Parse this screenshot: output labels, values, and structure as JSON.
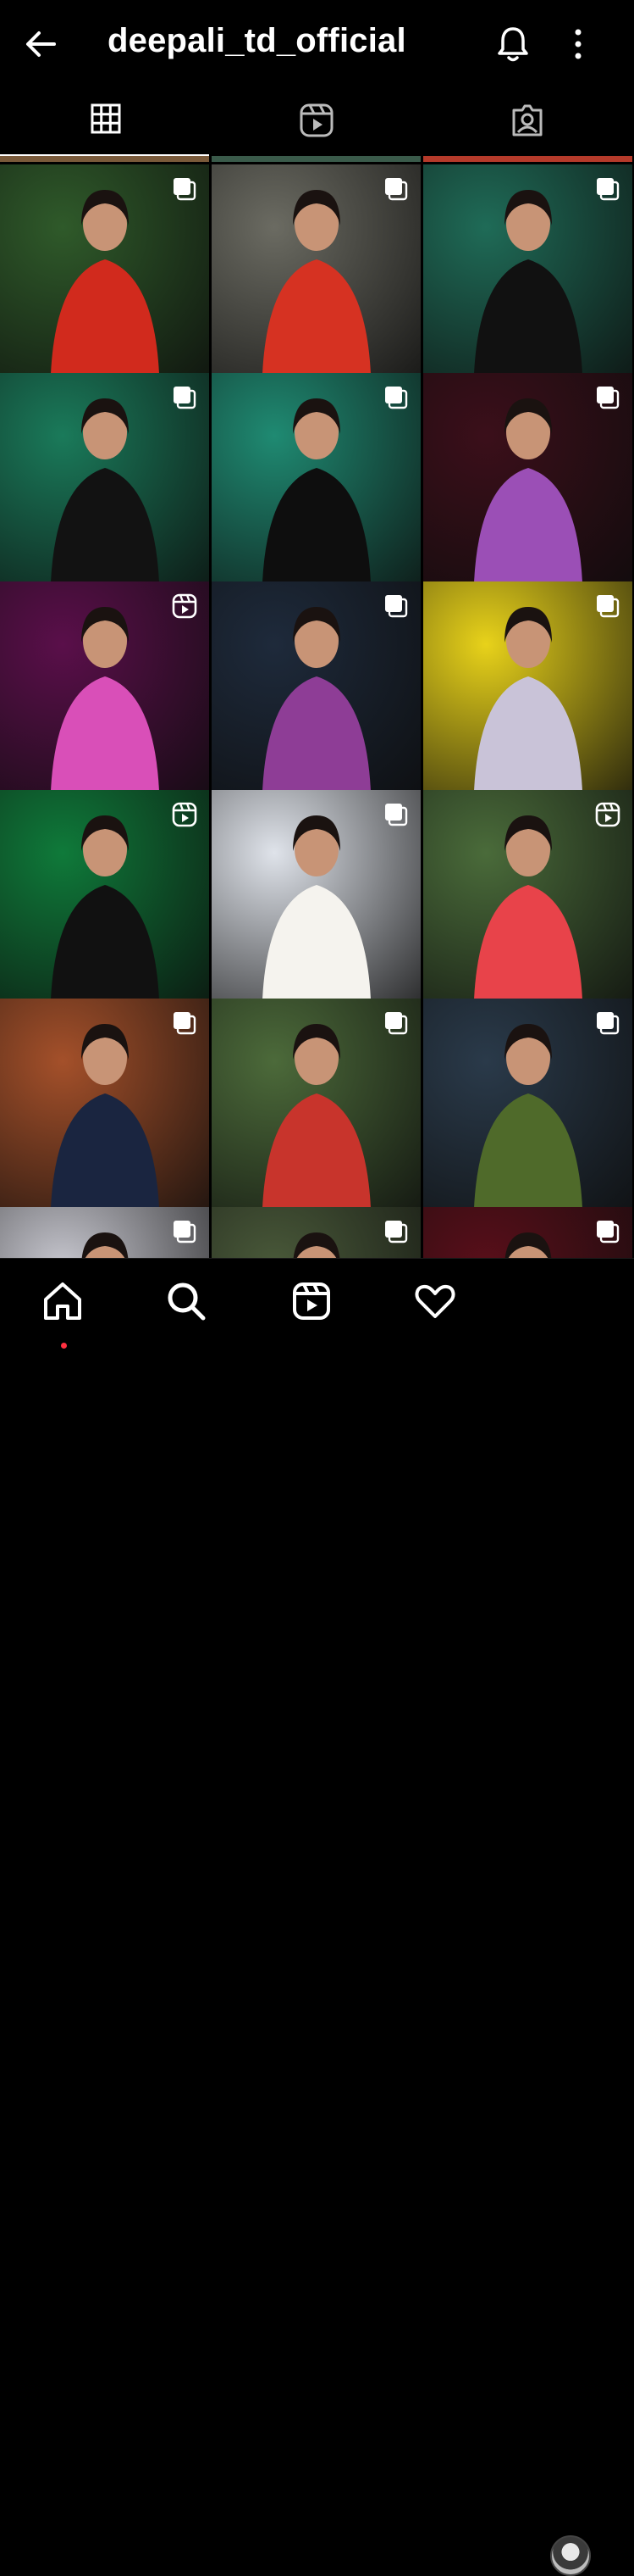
{
  "header": {
    "username": "deepali_td_official"
  },
  "tabs": [
    {
      "name": "posts",
      "icon": "grid-icon",
      "active": true
    },
    {
      "name": "reels",
      "icon": "reels-icon",
      "active": false
    },
    {
      "name": "tagged",
      "icon": "tagged-icon",
      "active": false
    }
  ],
  "grid": {
    "rows": [
      [
        {
          "badge": "multi-icon",
          "bg": "#2f5a2a",
          "accent": "#d12a1d"
        },
        {
          "badge": "multi-icon",
          "bg": "#6b6b62",
          "accent": "#d63222"
        },
        {
          "badge": "multi-icon",
          "bg": "#1f6b57",
          "accent": "#111111"
        }
      ],
      [
        {
          "badge": "multi-icon",
          "bg": "#1a7a5a",
          "accent": "#121212"
        },
        {
          "badge": "multi-icon",
          "bg": "#1f8a72",
          "accent": "#0e0e0e"
        },
        {
          "badge": "multi-icon",
          "bg": "#3b0f1a",
          "accent": "#9b4fb6"
        }
      ],
      [
        {
          "badge": "reel-icon",
          "bg": "#5a0f4a",
          "accent": "#d94fb8"
        },
        {
          "badge": "multi-icon",
          "bg": "#1e2a3b",
          "accent": "#8e3d96"
        },
        {
          "badge": "multi-icon",
          "bg": "#e8d21a",
          "accent": "#c9c3d8"
        }
      ],
      [
        {
          "badge": "reel-icon",
          "bg": "#0f7a3a",
          "accent": "#111111"
        },
        {
          "badge": "multi-icon",
          "bg": "#dfe3ea",
          "accent": "#f5f3ee"
        },
        {
          "badge": "reel-icon",
          "bg": "#4a6b3a",
          "accent": "#e8434a"
        }
      ],
      [
        {
          "badge": "multi-icon",
          "bg": "#a4502a",
          "accent": "#1a2540"
        },
        {
          "badge": "multi-icon",
          "bg": "#4c6a3a",
          "accent": "#c8342c"
        },
        {
          "badge": "multi-icon",
          "bg": "#2a3a4a",
          "accent": "#4f6a2a"
        }
      ],
      [
        {
          "badge": "multi-icon",
          "bg": "#c8c8d0",
          "accent": "#6a4a3a"
        },
        {
          "badge": "multi-icon",
          "bg": "#4a5a3a",
          "accent": "#caa27a"
        },
        {
          "badge": "multi-icon",
          "bg": "#5a0f1a",
          "accent": "#2a2a2a"
        }
      ]
    ]
  },
  "bottom_nav": [
    {
      "name": "home",
      "icon": "home-icon"
    },
    {
      "name": "search",
      "icon": "search-icon"
    },
    {
      "name": "reels",
      "icon": "reels-icon"
    },
    {
      "name": "activity",
      "icon": "heart-icon"
    },
    {
      "name": "profile",
      "icon": "avatar"
    }
  ]
}
